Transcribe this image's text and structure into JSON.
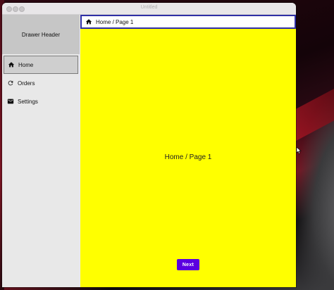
{
  "window": {
    "title": "Untitled"
  },
  "drawer": {
    "header": "Drawer Header",
    "items": [
      {
        "label": "Home",
        "icon": "home-icon",
        "selected": true
      },
      {
        "label": "Orders",
        "icon": "refresh-icon",
        "selected": false
      },
      {
        "label": "Settings",
        "icon": "mail-icon",
        "selected": false
      }
    ]
  },
  "breadcrumb": {
    "icon": "home-icon",
    "text": "Home / Page 1"
  },
  "main": {
    "center_text": "Home / Page 1",
    "next_label": "Next",
    "background": "#ffff00",
    "button_color": "#5b00e0"
  }
}
